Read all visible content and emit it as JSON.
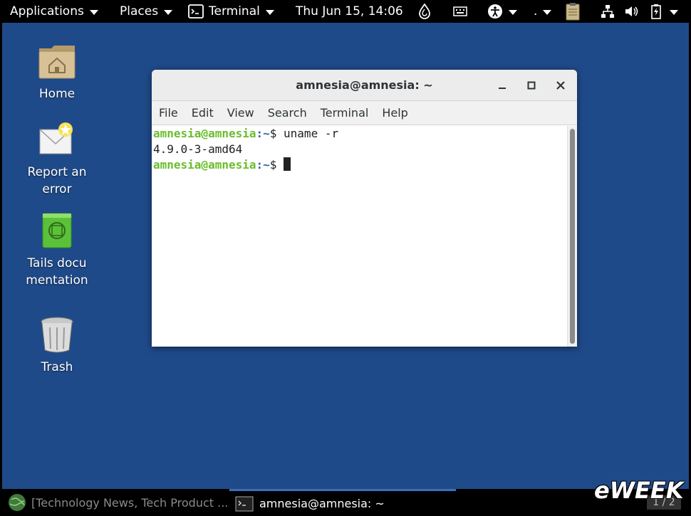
{
  "topbar": {
    "applications": "Applications",
    "places": "Places",
    "app_menu": "Terminal",
    "clock": "Thu Jun 15, 14:06",
    "keyboard_indicator": "."
  },
  "desktop": {
    "icons": [
      {
        "label": "Home",
        "icon": "home-folder-icon"
      },
      {
        "label": "Report an error",
        "icon": "report-error-icon"
      },
      {
        "label": "Tails documentation",
        "icon": "tails-documentation-icon"
      },
      {
        "label": "Trash",
        "icon": "trash-icon"
      }
    ]
  },
  "terminal": {
    "title": "amnesia@amnesia: ~",
    "menu": [
      "File",
      "Edit",
      "View",
      "Search",
      "Terminal",
      "Help"
    ],
    "lines": [
      {
        "user": "amnesia@amnesia",
        "path": ":~",
        "rest": "$ uname -r"
      },
      {
        "output": "4.9.0-3-amd64"
      },
      {
        "user": "amnesia@amnesia",
        "path": ":~",
        "rest": "$ "
      }
    ]
  },
  "taskbar": {
    "browser_task": "[Technology News, Tech Product ...",
    "terminal_task": "amnesia@amnesia: ~",
    "workspace": "1 / 2",
    "watermark": "eWEEK"
  },
  "colors": {
    "desktop_bg": "#1f4a89",
    "prompt_user": "#6bbd2c",
    "prompt_path": "#3465a4"
  }
}
